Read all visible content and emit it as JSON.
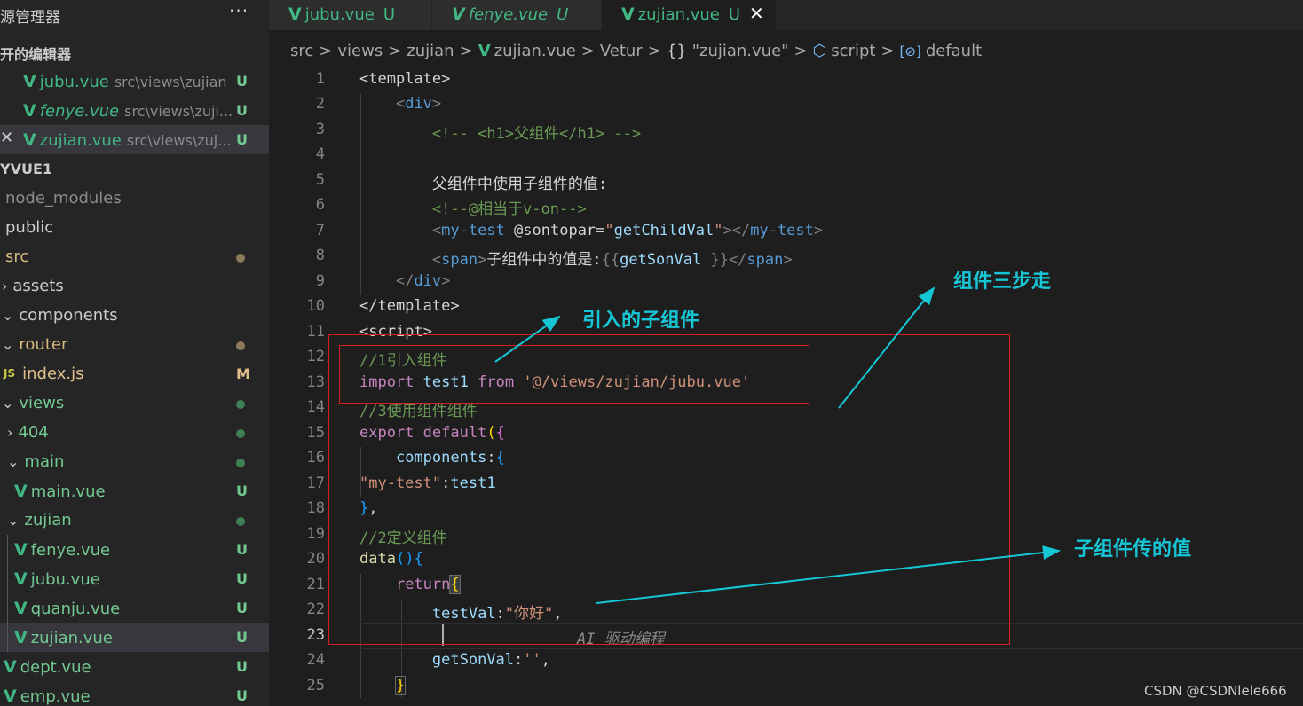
{
  "sidebar": {
    "title": "源管理器",
    "more": "···",
    "open_editors_title": "开的编辑器",
    "open_editors": [
      {
        "name": "jubu.vue",
        "path": "src\\views\\zujian",
        "status": "U"
      },
      {
        "name": "fenye.vue",
        "path": "src\\views\\zuji...",
        "status": "U"
      },
      {
        "name": "zujian.vue",
        "path": "src\\views\\zuj...",
        "status": "U",
        "close": "✕"
      }
    ],
    "project_title": "YVUE1",
    "tree": {
      "node_modules": "node_modules",
      "public": "public",
      "src": "src",
      "assets": "assets",
      "components": "components",
      "router": "router",
      "index_js": "index.js",
      "index_js_status": "M",
      "js_icon": "JS",
      "views": "views",
      "f404": "404",
      "main": "main",
      "main_vue": "main.vue",
      "zujian": "zujian",
      "fenye_vue": "fenye.vue",
      "jubu_vue": "jubu.vue",
      "quanju_vue": "quanju.vue",
      "zujian_vue": "zujian.vue",
      "dept_vue": "dept.vue",
      "emp_vue": "emp.vue",
      "status_u": "U"
    }
  },
  "tabs": [
    {
      "label": "jubu.vue",
      "status": "U"
    },
    {
      "label": "fenye.vue",
      "status": "U"
    },
    {
      "label": "zujian.vue",
      "status": "U",
      "close": "✕"
    }
  ],
  "breadcrumb": {
    "parts": [
      "src",
      "views",
      "zujian",
      "zujian.vue",
      "Vetur",
      "\"zujian.vue\"",
      "script",
      "default"
    ],
    "sep": ">",
    "braces": "{}"
  },
  "editor": {
    "line_numbers": [
      "1",
      "2",
      "3",
      "4",
      "5",
      "6",
      "7",
      "8",
      "9",
      "10",
      "11",
      "12",
      "13",
      "14",
      "15",
      "16",
      "17",
      "18",
      "19",
      "20",
      "21",
      "22",
      "23",
      "24",
      "25"
    ],
    "ghost_text": "AI 驱动编程"
  },
  "annotations": {
    "import_note": "引入的子组件",
    "steps_note": "组件三步走",
    "value_note": "子组件传的值"
  },
  "watermark": "CSDN @CSDNlele666",
  "colors": {
    "annotation": "#15c7d6",
    "box": "#d42020",
    "vue_green": "#41b883"
  }
}
